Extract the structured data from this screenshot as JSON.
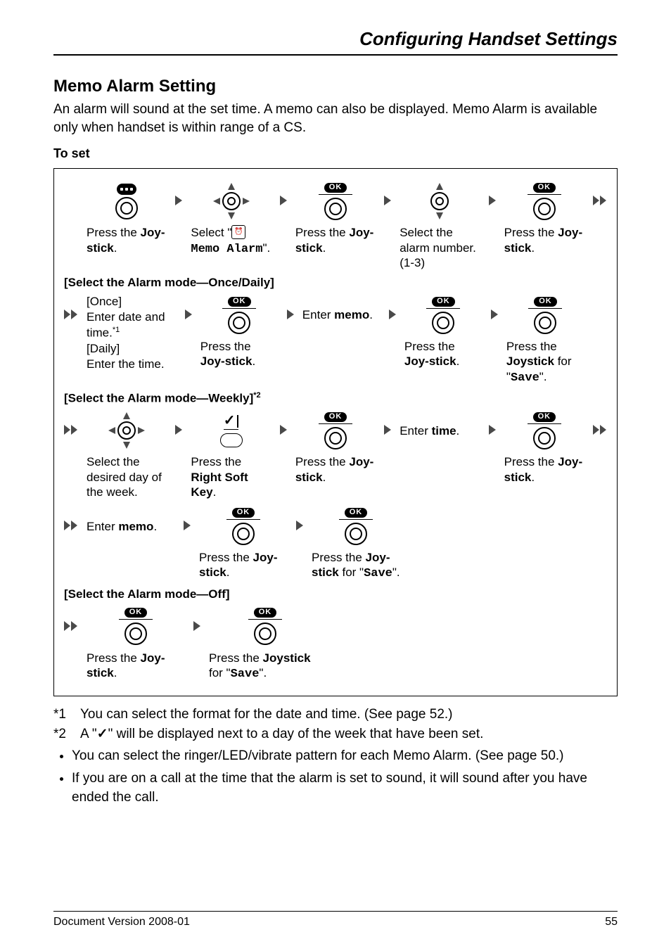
{
  "header": {
    "title": "Configuring Handset Settings"
  },
  "section": {
    "title": "Memo Alarm Setting",
    "intro": "An alarm will sound at the set time. A memo can also be displayed. Memo Alarm is available only when handset is within range of a CS.",
    "to_set": "To set"
  },
  "labels": {
    "press_joy_pre": "Press the ",
    "joy": "Joy-stick",
    "joystick_full": "Joystick",
    "select_pre": "Select \"",
    "memo_alarm": "Memo Alarm",
    "select_post": "\".",
    "select_alarm_number": "Select the alarm number. (1-3)",
    "once_daily_header": "[Select the Alarm mode—Once/Daily]",
    "once_daily_block_once": "[Once]",
    "once_daily_block_enter_dt": "Enter date and time.",
    "fn_star1": "*1",
    "once_daily_block_daily": "[Daily]",
    "once_daily_block_enter_t": "Enter the time.",
    "enter_memo_pre": "Enter ",
    "memo_bold": "memo",
    "enter_time_pre": "Enter ",
    "time_bold": "time",
    "for_save_pre": " for \"",
    "save_mono": "Save",
    "for_save_post": "\".",
    "weekly_header_base": "[Select the Alarm mode—Weekly]",
    "fn_star2": "*2",
    "select_day": "Select the desired day of the week.",
    "press_right_sk_pre": "Press the ",
    "right_sk": "Right Soft Key",
    "off_header": "[Select the Alarm mode—Off]"
  },
  "footnotes": {
    "fn1_key": "*1",
    "fn1_text": "You can select the format for the date and time. (See page 52.)",
    "fn2_key": "*2",
    "fn2_text_pre": "A \"",
    "fn2_text_post": "\" will be displayed next to a day of the week that have been set."
  },
  "notes": [
    "You can select the ringer/LED/vibrate pattern for each Memo Alarm. (See page 50.)",
    "If you are on a call at the time that the alarm is set to sound, it will sound after you have ended the call."
  ],
  "footer": {
    "version": "Document Version 2008-01",
    "page": "55"
  }
}
